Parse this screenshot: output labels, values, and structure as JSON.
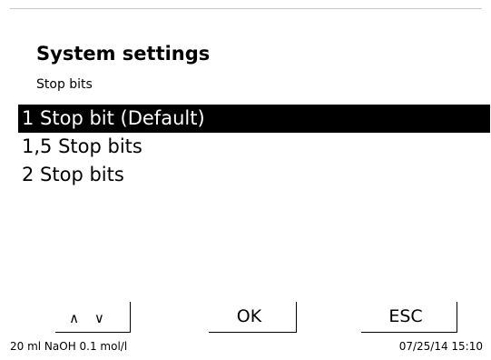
{
  "header": {
    "title": "System settings",
    "subtitle": "Stop bits"
  },
  "options": [
    {
      "label": "1 Stop bit (Default)",
      "selected": true
    },
    {
      "label": "1,5 Stop bits",
      "selected": false
    },
    {
      "label": "2 Stop bits",
      "selected": false
    }
  ],
  "softkeys": {
    "updown_label": "∧ ∨",
    "ok_label": "OK",
    "esc_label": "ESC"
  },
  "status": {
    "reagent": "20 ml NaOH 0.1 mol/l",
    "datetime": "07/25/14 15:10"
  },
  "colors": {
    "background": "#ffffff",
    "text": "#000000",
    "selection_background": "#000000",
    "selection_text": "#ffffff"
  }
}
